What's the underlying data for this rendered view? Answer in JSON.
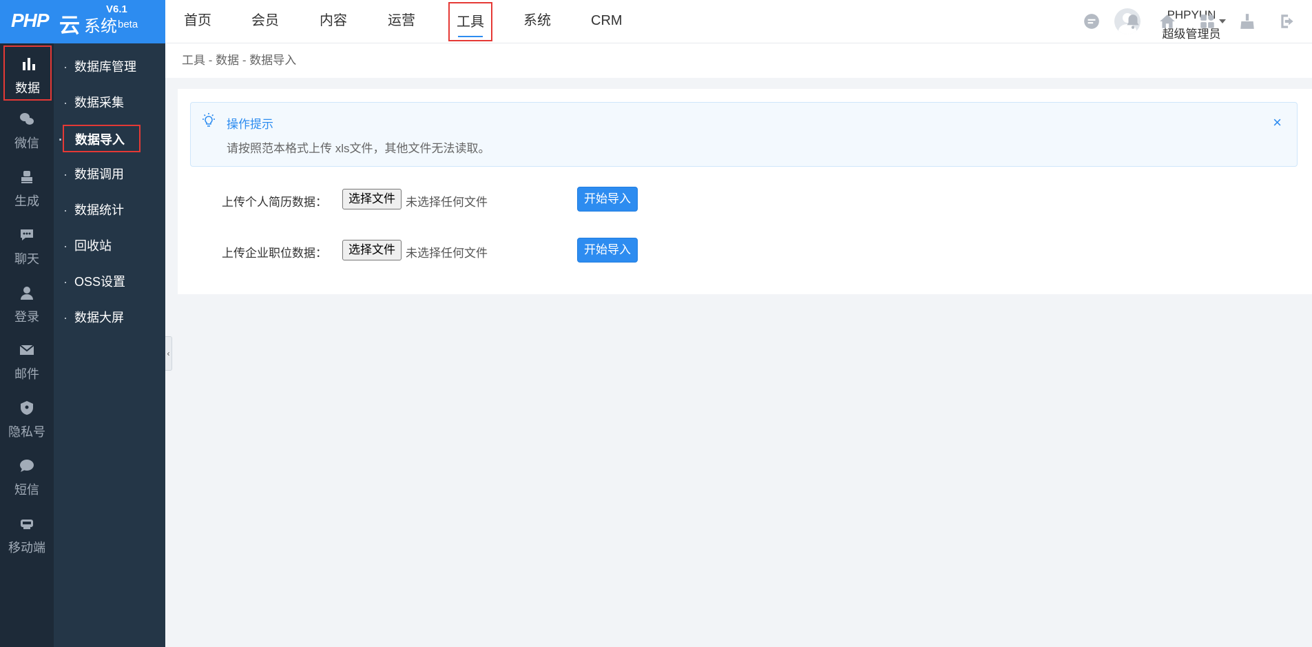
{
  "logo": {
    "brand": "PHP",
    "cloud": "云",
    "system": "系统",
    "version": "V6.1",
    "beta": "beta"
  },
  "topnav": [
    {
      "label": "首页"
    },
    {
      "label": "会员"
    },
    {
      "label": "内容"
    },
    {
      "label": "运营"
    },
    {
      "label": "工具",
      "active": true
    },
    {
      "label": "系统"
    },
    {
      "label": "CRM"
    }
  ],
  "user": {
    "name": "PHPYUN",
    "role": "超级管理员"
  },
  "top_icons": [
    "chat-bubble-icon",
    "bell-icon",
    "home-icon",
    "apps-grid-icon",
    "broom-icon",
    "logout-icon"
  ],
  "rail": [
    {
      "label": "数据",
      "icon": "bar-chart-icon",
      "active": true
    },
    {
      "label": "微信",
      "icon": "wechat-icon"
    },
    {
      "label": "生成",
      "icon": "stamp-icon"
    },
    {
      "label": "聊天",
      "icon": "chat-icon"
    },
    {
      "label": "登录",
      "icon": "user-icon"
    },
    {
      "label": "邮件",
      "icon": "mail-icon"
    },
    {
      "label": "隐私号",
      "icon": "shield-icon"
    },
    {
      "label": "短信",
      "icon": "message-icon"
    },
    {
      "label": "移动端",
      "icon": "app-icon"
    }
  ],
  "submenu": [
    {
      "label": "数据库管理"
    },
    {
      "label": "数据采集"
    },
    {
      "label": "数据导入",
      "active": true
    },
    {
      "label": "数据调用"
    },
    {
      "label": "数据统计"
    },
    {
      "label": "回收站"
    },
    {
      "label": "OSS设置"
    },
    {
      "label": "数据大屏"
    }
  ],
  "breadcrumb": "工具 - 数据 - 数据导入",
  "tip": {
    "title": "操作提示",
    "text": "请按照范本格式上传 xls文件，其他文件无法读取。",
    "close": "×"
  },
  "uploads": [
    {
      "label": "上传个人简历数据：",
      "file_button": "选择文件",
      "file_status": "未选择任何文件",
      "submit": "开始导入"
    },
    {
      "label": "上传企业职位数据：",
      "file_button": "选择文件",
      "file_status": "未选择任何文件",
      "submit": "开始导入"
    }
  ],
  "colors": {
    "primary": "#2d8cf0",
    "rail_bg": "#1d2a38",
    "submenu_bg": "#243647",
    "highlight": "#e53935"
  }
}
